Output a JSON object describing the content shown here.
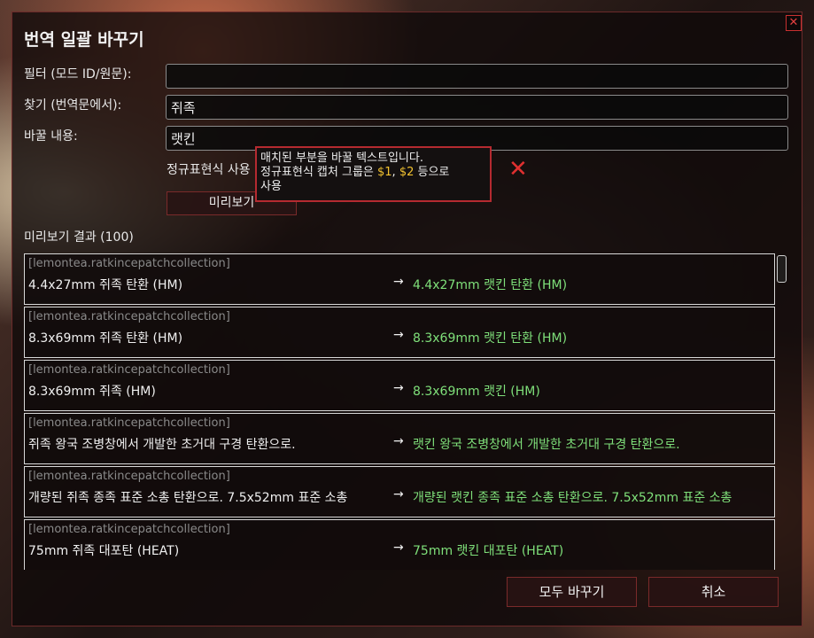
{
  "dialog": {
    "title": "번역 일괄 바꾸기",
    "close_glyph": "✕",
    "filter_label": "필터 (모드 ID/원문):",
    "filter_value": "",
    "find_label": "찾기 (번역문에서):",
    "find_value": "쥐족",
    "replace_label": "바꿀 내용:",
    "replace_value": "랫킨",
    "regex_label": "정규표현식 사용",
    "preview_button": "미리보기",
    "tooltip": {
      "line1": "매치된 부분을 바꿀 텍스트입니다.",
      "line2_pre": "정규표현식 캡처 그룹은 ",
      "g1": "$1",
      "comma": ", ",
      "g2": "$2",
      "line2_post": " 등으로",
      "line3": "사용"
    },
    "results_label": "미리보기 결과 (100)",
    "results": [
      {
        "mod": "[lemontea.ratkincepatchcollection]",
        "source": "4.4x27mm 쥐족 탄환 (HM)",
        "arrow": "→",
        "target": "4.4x27mm 랫킨 탄환 (HM)"
      },
      {
        "mod": "[lemontea.ratkincepatchcollection]",
        "source": "8.3x69mm 쥐족 탄환 (HM)",
        "arrow": "→",
        "target": "8.3x69mm 랫킨 탄환 (HM)"
      },
      {
        "mod": "[lemontea.ratkincepatchcollection]",
        "source": "8.3x69mm 쥐족 (HM)",
        "arrow": "→",
        "target": "8.3x69mm 랫킨 (HM)"
      },
      {
        "mod": "[lemontea.ratkincepatchcollection]",
        "source": "쥐족 왕국 조병창에서 개발한 초거대 구경 탄환으로.",
        "arrow": "→",
        "target": "랫킨 왕국 조병창에서 개발한 초거대 구경 탄환으로."
      },
      {
        "mod": "[lemontea.ratkincepatchcollection]",
        "source": "개량된 쥐족 종족 표준 소총 탄환으로. 7.5x52mm 표준 소총",
        "arrow": "→",
        "target": "개량된 랫킨 종족 표준 소총 탄환으로. 7.5x52mm 표준 소총"
      },
      {
        "mod": "[lemontea.ratkincepatchcollection]",
        "source": "75mm 쥐족 대포탄 (HEAT)",
        "arrow": "→",
        "target": "75mm 랫킨 대포탄 (HEAT)"
      }
    ],
    "replace_all_button": "모두 바꾸기",
    "cancel_button": "취소",
    "error_glyph": "✕"
  }
}
